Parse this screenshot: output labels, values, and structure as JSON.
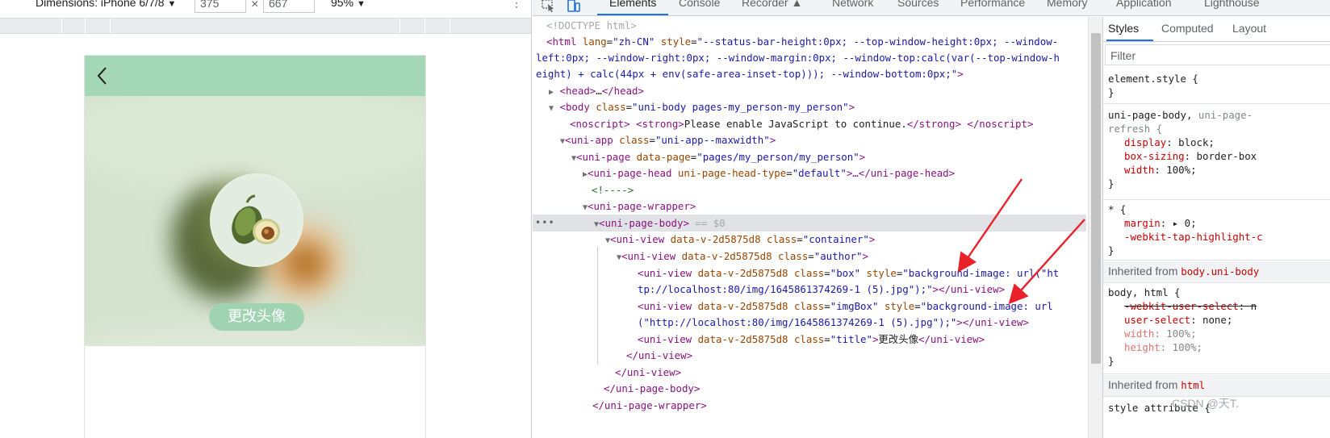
{
  "device_toolbar": {
    "dimensions_label": "Dimensions: iPhone 6/7/8",
    "dropdown_glyph": "▼",
    "width": "375",
    "times": "×",
    "height": "667",
    "zoom": "95%",
    "kebab": "⋮"
  },
  "phone": {
    "change_avatar_label": "更改头像"
  },
  "devtools_tabs": [
    "Elements",
    "Console",
    "Recorder ▲",
    "Network",
    "Sources",
    "Performance",
    "Memory",
    "Application",
    "Lighthouse"
  ],
  "dom_lines": {
    "l0": "<!DOCTYPE html>",
    "l1_tag": "<html",
    "l1_a1": " lang",
    "l1_v1": "\"zh-CN\"",
    "l1_a2": " style",
    "l1_v2": "\"--status-bar-height:0px; --top-window-height:0px; --window-",
    "l2": "left:0px; --window-right:0px; --window-margin:0px; --window-top:calc(var(--top-window-h",
    "l3": "eight) + calc(44px + env(safe-area-inset-top))); --window-bottom:0px;\"",
    "l3_end": ">",
    "l4_tag": "<head>",
    "l4_dots": "…",
    "l4_end": "</head>",
    "l5_tag": "<body",
    "l5_attr": " class",
    "l5_val": "\"uni-body pages-my_person-my_person\"",
    "l5_end": ">",
    "l6_tag": "<noscript>",
    "l6_strong": " <strong>",
    "l6_text": "Please enable JavaScript to continue.",
    "l6_strong_end": "</strong>",
    "l6_end": " </noscript>",
    "l7_tag": "<uni-app",
    "l7_attr": " class",
    "l7_val": "\"uni-app--maxwidth\"",
    "l7_end": ">",
    "l8_tag": "<uni-page",
    "l8_attr": " data-page",
    "l8_val": "\"pages/my_person/my_person\"",
    "l8_end": ">",
    "l9_tag": "<uni-page-head",
    "l9_attr": " uni-page-head-type",
    "l9_val": "\"default\"",
    "l9_mid": ">…",
    "l9_end": "</uni-page-head>",
    "l10": "<!---->",
    "l11": "<uni-page-wrapper>",
    "l12_tag": "<uni-page-body>",
    "l12_eq": " == $0",
    "l13_tag": "<uni-view",
    "l13_a1": " data-v-2d5875d8",
    "l13_a2": " class",
    "l13_val": "\"container\"",
    "l13_end": ">",
    "l14_tag": "<uni-view",
    "l14_a1": " data-v-2d5875d8",
    "l14_a2": " class",
    "l14_val": "\"author\"",
    "l14_end": ">",
    "l15_tag": "<uni-view",
    "l15_a1": " data-v-2d5875d8",
    "l15_a2": " class",
    "l15_v1": "\"box\"",
    "l15_a3": " style",
    "l15_v2": "\"background-image: url(\"ht",
    "l16_v": "tp://localhost:80/img/1645861374269-1 (5).jpg\");\"",
    "l16_end": "></uni-view>",
    "l17_tag": "<uni-view",
    "l17_a1": " data-v-2d5875d8",
    "l17_a2": " class",
    "l17_v1": "\"imgBox\"",
    "l17_a3": " style",
    "l17_v2": "\"background-image: url",
    "l18_v": "(\"http://localhost:80/img/1645861374269-1 (5).jpg\");\"",
    "l18_end": "></uni-view>",
    "l19_tag": "<uni-view",
    "l19_a1": " data-v-2d5875d8",
    "l19_a2": " class",
    "l19_val": "\"title\"",
    "l19_gt": ">",
    "l19_text": "更改头像",
    "l19_end": "</uni-view>",
    "l20": "</uni-view>",
    "l21": "</uni-view>",
    "l22": "</uni-page-body>",
    "l23": "</uni-page-wrapper>"
  },
  "styles": {
    "tabs": [
      "Styles",
      "Computed",
      "Layout"
    ],
    "filter_placeholder": "Filter",
    "rule1_sel": "element.style {",
    "close": "}",
    "rule2_sel_a": "uni-page-body,",
    "rule2_sel_b": " uni-page-",
    "rule2_sel_c": "refresh {",
    "r2_p1": "display",
    "r2_v1": ": block;",
    "r2_p2": "box-sizing",
    "r2_v2": ": border-box",
    "r2_p3": "width",
    "r2_v3": ": 100%;",
    "rule3_sel": "* {",
    "r3_p1": "margin",
    "r3_v1": ": ▸ 0;",
    "r3_p2": "-webkit-tap-highlight-c",
    "inh1_label": "Inherited from ",
    "inh1_src": "body.uni-body",
    "rule4_sel": "body, html {",
    "r4_p1": "-webkit-user-select",
    "r4_v1": ": n",
    "r4_p2": "user-select",
    "r4_v2": ": none;",
    "r4_p3": "width",
    "r4_v3": ": 100%;",
    "r4_p4": "height",
    "r4_v4": ": 100%;",
    "inh2_label": "Inherited from ",
    "inh2_src": "html",
    "rule5_sel": "style attribute {"
  },
  "watermark": "CSDN @天T.",
  "colors": {
    "nav_bar": "#a4d7b6",
    "button": "#9fd3b1",
    "selection": "#e1e2e5",
    "accent": "#1a73e8",
    "annotation_arrow": "#e8212b"
  }
}
